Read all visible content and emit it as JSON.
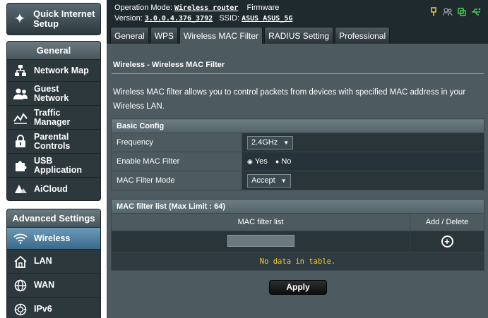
{
  "sidebar": {
    "qis_label_1": "Quick Internet",
    "qis_label_2": "Setup",
    "general_header": "General",
    "general_items": [
      {
        "l1": "Network Map",
        "l2": "",
        "icon": "network-map-icon"
      },
      {
        "l1": "Guest",
        "l2": "Network",
        "icon": "guest-network-icon"
      },
      {
        "l1": "Traffic",
        "l2": "Manager",
        "icon": "traffic-manager-icon"
      },
      {
        "l1": "Parental",
        "l2": "Controls",
        "icon": "lock-icon"
      },
      {
        "l1": "USB",
        "l2": "Application",
        "icon": "puzzle-icon"
      },
      {
        "l1": "AiCloud",
        "l2": "",
        "icon": "cloud-icon"
      }
    ],
    "advanced_header": "Advanced Settings",
    "advanced_items": [
      {
        "l1": "Wireless",
        "icon": "wifi-icon"
      },
      {
        "l1": "LAN",
        "icon": "home-icon"
      },
      {
        "l1": "WAN",
        "icon": "globe-icon"
      },
      {
        "l1": "IPv6",
        "icon": "ipv6-icon"
      }
    ]
  },
  "header": {
    "op_mode_label": "Operation Mode:",
    "op_mode_value": "Wireless router",
    "firmware_label": "Firmware",
    "version_label": "Version:",
    "version_value": "3.0.0.4.376_3792",
    "ssid_label": "SSID:",
    "ssid_value": "ASUS ASUS_5G",
    "status_icons": [
      "usb-status-icon",
      "clients-status-icon",
      "app-status-icon",
      "usb-connection-icon"
    ]
  },
  "tabs": [
    "General",
    "WPS",
    "Wireless MAC Filter",
    "RADIUS Setting",
    "Professional"
  ],
  "active_tab": "Wireless MAC Filter",
  "page": {
    "title": "Wireless - Wireless MAC Filter",
    "description": "Wireless MAC filter allows you to control packets from devices with specified MAC address in your Wireless LAN."
  },
  "basic_config": {
    "header": "Basic Config",
    "frequency_label": "Frequency",
    "frequency_value": "2.4GHz",
    "enable_label": "Enable MAC Filter",
    "yes_label": "Yes",
    "no_label": "No",
    "mode_label": "MAC Filter Mode",
    "mode_value": "Accept"
  },
  "mac_list": {
    "header": "MAC filter list (Max Limit : 64)",
    "col_mac": "MAC filter list",
    "col_action": "Add / Delete",
    "empty_text": "No data in table."
  },
  "apply_label": "Apply",
  "colors": {
    "panel": "#4d5a5f",
    "sidebar_dark": "#2d383d",
    "active_item": "#3a6a8c",
    "warning_text": "#f2cc2f"
  }
}
